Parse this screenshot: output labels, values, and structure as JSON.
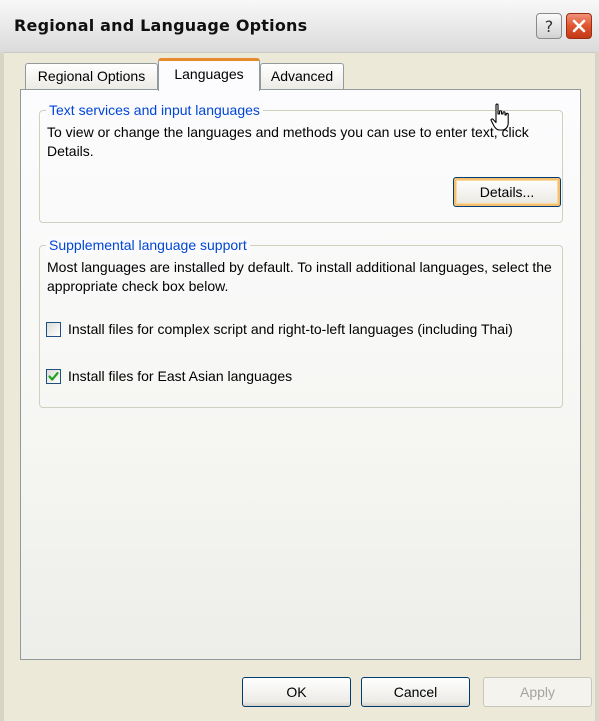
{
  "window": {
    "title": "Regional and Language Options"
  },
  "tabs": [
    {
      "label": "Regional Options",
      "selected": false
    },
    {
      "label": "Languages",
      "selected": true
    },
    {
      "label": "Advanced",
      "selected": false
    }
  ],
  "text_services": {
    "legend": "Text services and input languages",
    "description": "To view or change the languages and methods you can use to enter text, click Details.",
    "details_button": "Details..."
  },
  "supplemental": {
    "legend": "Supplemental language support",
    "description": "Most languages are installed by default. To install additional languages, select the appropriate check box below.",
    "complex_script_label": "Install files for complex script and right-to-left languages (including Thai)",
    "complex_script_checked": false,
    "east_asian_label": "Install files for East Asian languages",
    "east_asian_checked": true
  },
  "footer": {
    "ok": "OK",
    "cancel": "Cancel",
    "apply": "Apply"
  },
  "colors": {
    "accent_tab": "#e68b2c",
    "legend_text": "#0046d5",
    "close_button": "#e0542f"
  },
  "icons": [
    "help-icon",
    "close-icon",
    "checkmark-icon",
    "mouse-pointer-icon"
  ]
}
